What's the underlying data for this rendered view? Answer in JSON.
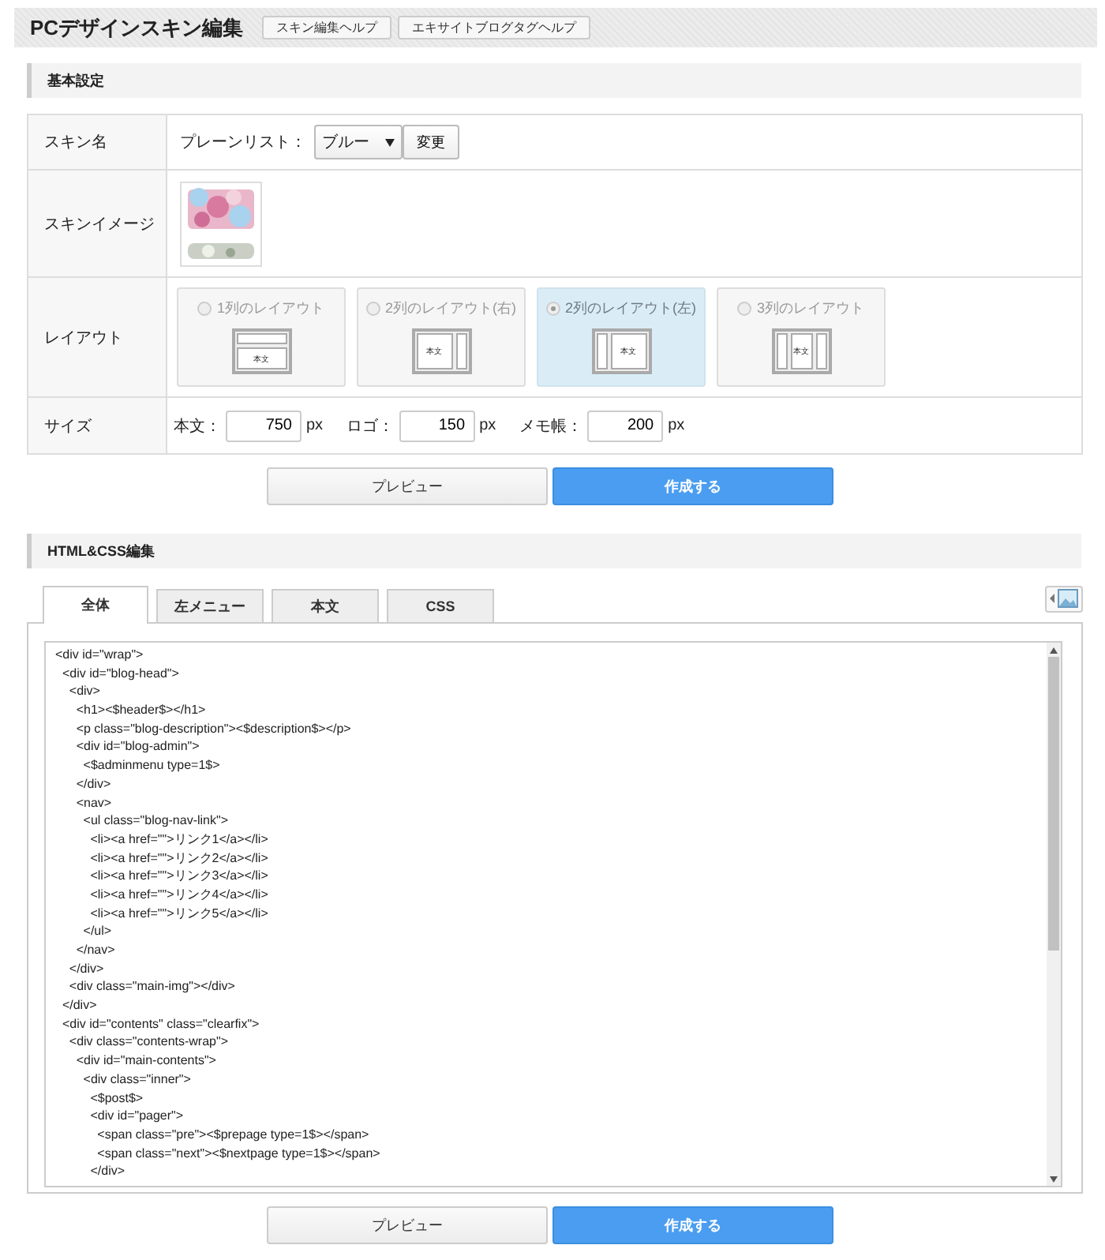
{
  "header": {
    "title": "PCデザインスキン編集",
    "help_buttons": [
      "スキン編集ヘルプ",
      "エキサイトブログタグヘルプ"
    ]
  },
  "basic": {
    "heading": "基本設定",
    "skin_name": {
      "label": "スキン名",
      "prefix": "プレーンリスト：",
      "select_value": "ブルー",
      "change_button": "変更"
    },
    "skin_image": {
      "label": "スキンイメージ"
    },
    "layout": {
      "label": "レイアウト",
      "options": [
        {
          "label": "1列のレイアウト",
          "kind": "one",
          "body": "本文",
          "selected": false
        },
        {
          "label": "2列のレイアウト(右)",
          "kind": "right",
          "body": "本文",
          "selected": false
        },
        {
          "label": "2列のレイアウト(左)",
          "kind": "left",
          "body": "本文",
          "selected": true
        },
        {
          "label": "3列のレイアウト",
          "kind": "three",
          "body": "本文",
          "selected": false
        }
      ]
    },
    "size": {
      "label": "サイズ",
      "fields": [
        {
          "label": "本文：",
          "value": "750",
          "unit": "px"
        },
        {
          "label": "ロゴ：",
          "value": "150",
          "unit": "px"
        },
        {
          "label": "メモ帳：",
          "value": "200",
          "unit": "px"
        }
      ]
    }
  },
  "actions_top": {
    "preview": "プレビュー",
    "create": "作成する"
  },
  "editor": {
    "heading": "HTML&CSS編集",
    "tabs": [
      {
        "label": "全体",
        "selected": true
      },
      {
        "label": "左メニュー",
        "selected": false
      },
      {
        "label": "本文",
        "selected": false
      },
      {
        "label": "CSS",
        "selected": false
      }
    ],
    "code": [
      "<div id=\"wrap\">",
      "  <div id=\"blog-head\">",
      "    <div>",
      "      <h1><$header$></h1>",
      "      <p class=\"blog-description\"><$description$></p>",
      "      <div id=\"blog-admin\">",
      "        <$adminmenu type=1$>",
      "      </div>",
      "      <nav>",
      "        <ul class=\"blog-nav-link\">",
      "          <li><a href=\"\">リンク1</a></li>",
      "          <li><a href=\"\">リンク2</a></li>",
      "          <li><a href=\"\">リンク3</a></li>",
      "          <li><a href=\"\">リンク4</a></li>",
      "          <li><a href=\"\">リンク5</a></li>",
      "        </ul>",
      "      </nav>",
      "    </div>",
      "    <div class=\"main-img\"></div>",
      "  </div>",
      "  <div id=\"contents\" class=\"clearfix\">",
      "    <div class=\"contents-wrap\">",
      "      <div id=\"main-contents\">",
      "        <div class=\"inner\">",
      "          <$post$>",
      "          <div id=\"pager\">",
      "            <span class=\"pre\"><$prepage type=1$></span>",
      "            <span class=\"next\"><$nextpage type=1$></span>",
      "          </div>"
    ]
  },
  "actions_bottom": {
    "preview": "プレビュー",
    "create": "作成する"
  }
}
